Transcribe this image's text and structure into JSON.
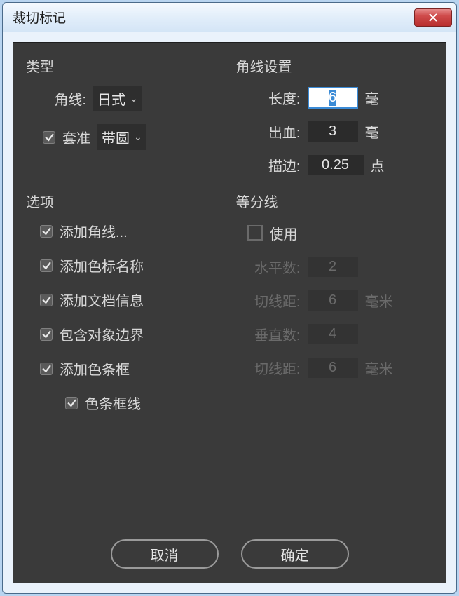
{
  "window": {
    "title": "裁切标记"
  },
  "type_group": {
    "title": "类型",
    "corner_label": "角线:",
    "corner_value": "日式",
    "register_label": "套准",
    "register_checked": true,
    "register_value": "带圆"
  },
  "corner_settings": {
    "title": "角线设置",
    "length_label": "长度:",
    "length_value": "6",
    "length_unit": "毫",
    "bleed_label": "出血:",
    "bleed_value": "3",
    "bleed_unit": "毫",
    "stroke_label": "描边:",
    "stroke_value": "0.25",
    "stroke_unit": "点"
  },
  "options": {
    "title": "选项",
    "items": [
      {
        "label": "添加角线...",
        "checked": true
      },
      {
        "label": "添加色标名称",
        "checked": true
      },
      {
        "label": "添加文档信息",
        "checked": true
      },
      {
        "label": "包含对象边界",
        "checked": true
      },
      {
        "label": "添加色条框",
        "checked": true
      },
      {
        "label": "色条框线",
        "checked": true,
        "indent": true
      }
    ]
  },
  "divide": {
    "title": "等分线",
    "use_label": "使用",
    "use_checked": false,
    "h_count_label": "水平数:",
    "h_count_value": "2",
    "h_gap_label": "切线距:",
    "h_gap_value": "6",
    "h_gap_unit": "毫米",
    "v_count_label": "垂直数:",
    "v_count_value": "4",
    "v_gap_label": "切线距:",
    "v_gap_value": "6",
    "v_gap_unit": "毫米"
  },
  "buttons": {
    "cancel": "取消",
    "ok": "确定"
  }
}
